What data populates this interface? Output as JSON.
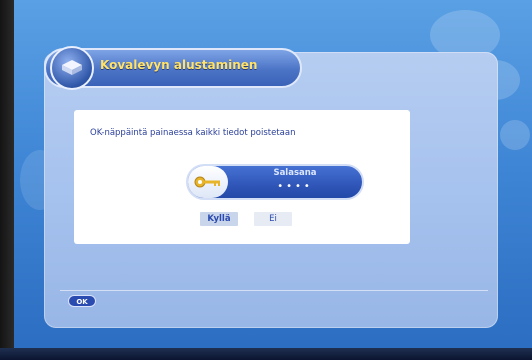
{
  "dialog": {
    "title": "Kovalevyn alustaminen",
    "message": "OK-näppäintä painaessa kaikki tiedot poistetaan",
    "password": {
      "label": "Salasana",
      "masked_value": "••••"
    },
    "buttons": {
      "yes": "Kyllä",
      "no": "Ei"
    }
  },
  "footer": {
    "ok_key": "OK"
  },
  "icons": {
    "title": "hard-drive-icon",
    "password": "key-icon",
    "footer": "ok-key-icon"
  },
  "colors": {
    "title_text": "#ffe26a",
    "message_text": "#2a3f9a",
    "panel": "#a6c2ee",
    "accent_blue": "#2f56b8"
  }
}
